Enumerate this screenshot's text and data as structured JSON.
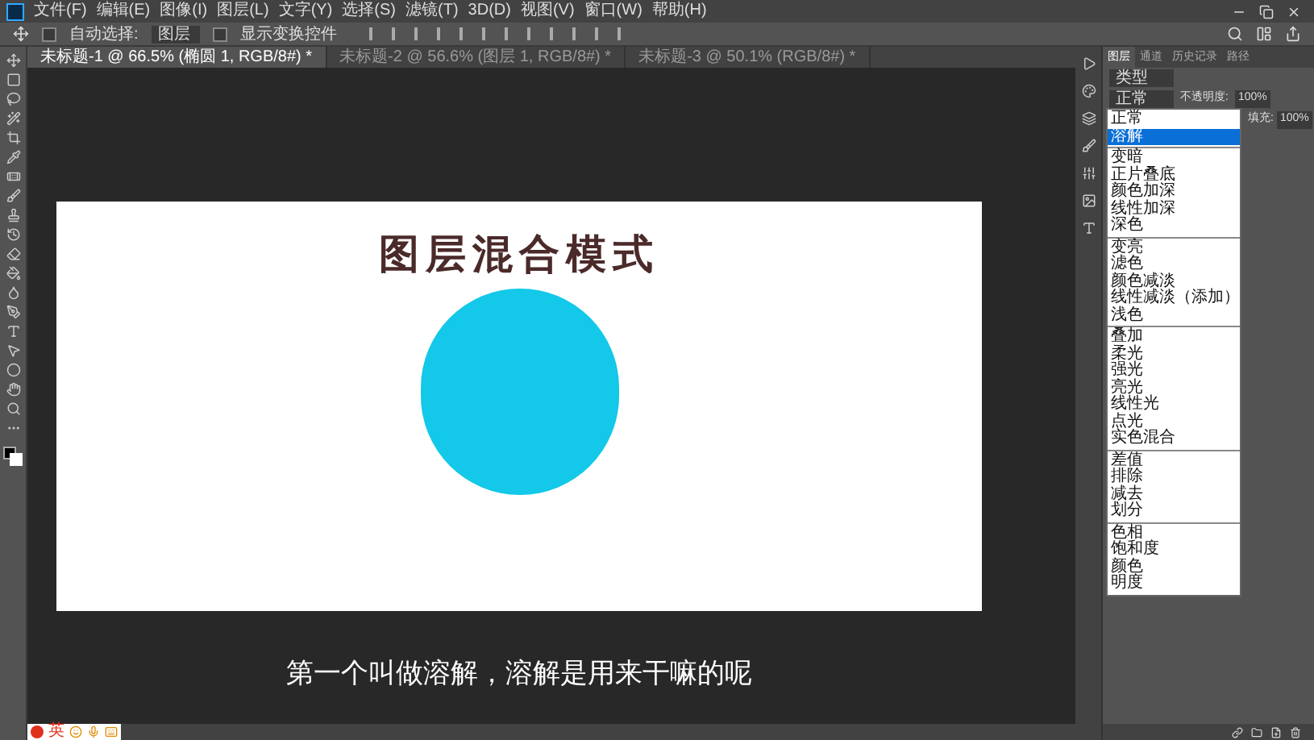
{
  "menu_bar": {
    "items": [
      "文件(F)",
      "编辑(E)",
      "图像(I)",
      "图层(L)",
      "文字(Y)",
      "选择(S)",
      "滤镜(T)",
      "3D(D)",
      "视图(V)",
      "窗口(W)",
      "帮助(H)"
    ]
  },
  "options_bar": {
    "auto_select": {
      "label": "自动选择:",
      "checked": false
    },
    "auto_select_target": "图层",
    "transform_controls": {
      "label": "显示变换控件",
      "checked": false
    }
  },
  "document_tabs": [
    {
      "label": "未标题-1 @ 66.5% (椭圆 1, RGB/8#) *",
      "selected": true
    },
    {
      "label": "未标题-2 @ 56.6% (图层 1, RGB/8#) *",
      "selected": false
    },
    {
      "label": "未标题-3 @ 50.1% (RGB/8#) *",
      "selected": false
    }
  ],
  "document": {
    "title": "图层混合模式"
  },
  "subtitle": "第一个叫做溶解，溶解是用来干嘛的呢",
  "layers_panel": {
    "tabs": [
      {
        "label": "图层",
        "selected": true
      },
      {
        "label": "通道",
        "selected": false
      },
      {
        "label": "历史记录",
        "selected": false
      },
      {
        "label": "路径",
        "selected": false
      }
    ],
    "filter": "类型",
    "blend_mode": "正常",
    "opacity_label": "不透明度:",
    "opacity": "100%",
    "fill_label": "填充:",
    "fill": "100%"
  },
  "blend_menu": {
    "groups": [
      [
        {
          "label": "正常",
          "selected": false
        },
        {
          "label": "溶解",
          "selected": true
        }
      ],
      [
        {
          "label": "变暗",
          "selected": false
        },
        {
          "label": "正片叠底",
          "selected": false
        },
        {
          "label": "颜色加深",
          "selected": false
        },
        {
          "label": "线性加深",
          "selected": false
        },
        {
          "label": "深色",
          "selected": false
        }
      ],
      [
        {
          "label": "变亮",
          "selected": false
        },
        {
          "label": "滤色",
          "selected": false
        },
        {
          "label": "颜色减淡",
          "selected": false
        },
        {
          "label": "线性减淡（添加）",
          "selected": false
        },
        {
          "label": "浅色",
          "selected": false
        }
      ],
      [
        {
          "label": "叠加",
          "selected": false
        },
        {
          "label": "柔光",
          "selected": false
        },
        {
          "label": "强光",
          "selected": false
        },
        {
          "label": "亮光",
          "selected": false
        },
        {
          "label": "线性光",
          "selected": false
        },
        {
          "label": "点光",
          "selected": false
        },
        {
          "label": "实色混合",
          "selected": false
        }
      ],
      [
        {
          "label": "差值",
          "selected": false
        },
        {
          "label": "排除",
          "selected": false
        },
        {
          "label": "减去",
          "selected": false
        },
        {
          "label": "划分",
          "selected": false
        }
      ],
      [
        {
          "label": "色相",
          "selected": false
        },
        {
          "label": "饱和度",
          "selected": false
        },
        {
          "label": "颜色",
          "selected": false
        },
        {
          "label": "明度",
          "selected": false
        }
      ]
    ]
  },
  "ime_bar": {
    "mode": "英"
  }
}
